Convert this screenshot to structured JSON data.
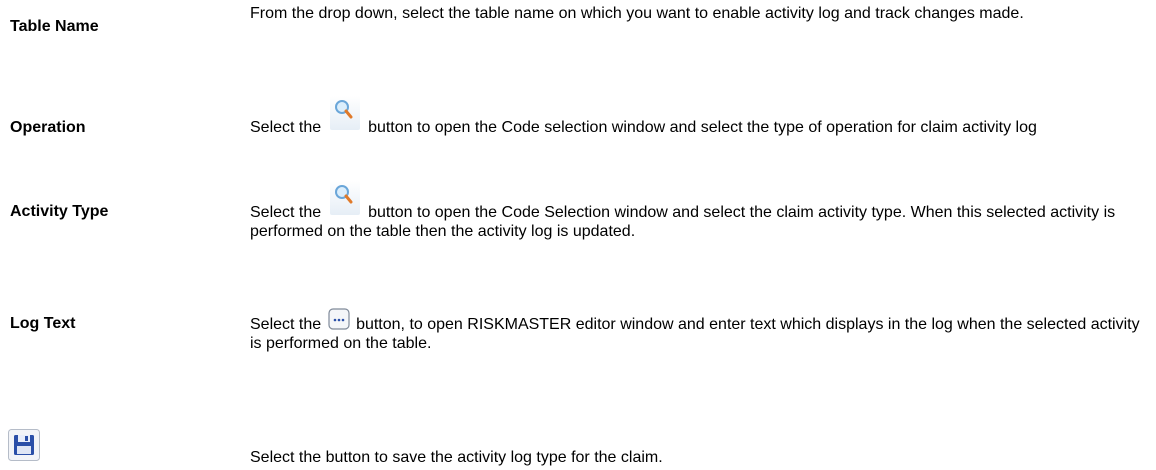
{
  "rows": [
    {
      "term": "Table Name",
      "desc": "From the drop down, select the table name on which you want to enable activity log and track changes made."
    },
    {
      "term": "Operation",
      "desc_before": "Select the",
      "desc_after": "button to open the Code selection window and select the type of operation for claim activity log",
      "icon": "magnifier-icon"
    },
    {
      "term": "Activity Type",
      "desc_before": "Select the",
      "desc_after": "button to open the Code Selection window and select the claim activity type. When this selected activity is performed on the table then the activity log is updated.",
      "icon": "magnifier-icon"
    },
    {
      "term": "Log Text",
      "desc_before": "Select the",
      "desc_after": "button, to open RISKMASTER editor window and enter text which displays in the log when the selected activity is performed on the table.",
      "icon": "ellipsis-button-icon"
    },
    {
      "desc": "Select the button to save the activity log type for the claim.",
      "icon": "save-disk-icon"
    }
  ],
  "colors": {
    "text": "#000000",
    "magnifier_lens": "#6aa6d9",
    "magnifier_handle": "#e07a2a",
    "save_icon_blue": "#2a4fa8"
  }
}
